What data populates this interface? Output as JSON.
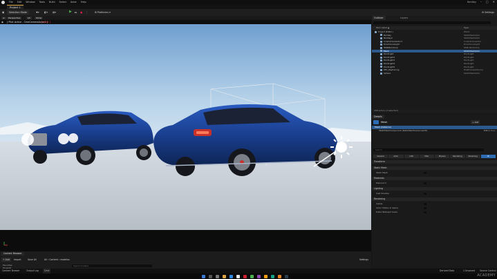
{
  "menu": [
    "File",
    "Edit",
    "Window",
    "Tools",
    "Build",
    "Select",
    "Actor",
    "Help"
  ],
  "project_tab": "Project 1",
  "project_name": "Bentley",
  "window_controls": [
    "–",
    "□",
    "✕"
  ],
  "toolbar": {
    "selection_mode": "Selection Mode",
    "platforms": "Platforms",
    "settings": "Settings"
  },
  "viewport": {
    "view_mode": "Perspective",
    "lit": "Lit",
    "show": "Show",
    "pilot_text": "[ Pilot Active - CineCameraActor1 ]",
    "pilot_exit": "[ eject ]"
  },
  "outliner": {
    "tab": "Outliner",
    "tab2": "Layers",
    "header_label": "Item Label ▲",
    "header_type": "Type",
    "rows": [
      {
        "label": "Project (Editor)",
        "type": "World",
        "indent": 0,
        "selected": false
      },
      {
        "label": "Bentley",
        "type": "StaticMeshActor",
        "indent": 1,
        "selected": false
      },
      {
        "label": "Bentley2",
        "type": "StaticMeshActor",
        "indent": 1,
        "selected": false
      },
      {
        "label": "CineCameraActor1",
        "type": "CineCameraActor",
        "indent": 1,
        "selected": false
      },
      {
        "label": "DirectionalLight",
        "type": "DirectionalLight",
        "indent": 1,
        "selected": false
      },
      {
        "label": "HDRIBackdrop",
        "type": "HDRI BACKdrop",
        "indent": 1,
        "selected": false
      },
      {
        "label": "Mesh",
        "type": "StaticMeshActor",
        "indent": 1,
        "selected": true
      },
      {
        "label": "PointLight",
        "type": "PointLight",
        "indent": 1,
        "selected": false
      },
      {
        "label": "PointLight2",
        "type": "PointLight",
        "indent": 1,
        "selected": false
      },
      {
        "label": "PointLight3",
        "type": "PointLight",
        "indent": 1,
        "selected": false
      },
      {
        "label": "PointLight4",
        "type": "PointLight",
        "indent": 1,
        "selected": false
      },
      {
        "label": "PointLight5",
        "type": "PointLight",
        "indent": 1,
        "selected": false
      },
      {
        "label": "PPV_Raytracing",
        "type": "PostProcessVolume",
        "indent": 1,
        "selected": false
      },
      {
        "label": "Sphere",
        "type": "StaticMeshActor",
        "indent": 1,
        "selected": false
      }
    ],
    "footer": "156 actors (1 selected)"
  },
  "details": {
    "tab": "Details",
    "actor_name": "Mesh",
    "add_button": "+ Add",
    "root_component": "Mesh (Instance)",
    "component": "StaticMeshComponent (StaticMeshComponent0)",
    "edit_label": "Edit in C++",
    "search_placeholder": "Search",
    "filter_tabs": [
      "General",
      "Actor",
      "LOD",
      "Misc",
      "Physics",
      "Rendering",
      "Streaming",
      "All"
    ],
    "sections": [
      {
        "name": "Transform",
        "rows": []
      },
      {
        "name": "Static Mesh",
        "rows": [
          "Static Mesh"
        ]
      },
      {
        "name": "Materials",
        "rows": [
          "Element 0"
        ]
      },
      {
        "name": "Lighting",
        "rows": [
          "Cast Shadow"
        ]
      },
      {
        "name": "Rendering",
        "rows": [
          "Visible",
          "Actor Hidden In Game",
          "Editor Billboard Scale"
        ]
      }
    ]
  },
  "content_browser": {
    "tab": "Content Browser",
    "add": "+ Add",
    "import": "Import",
    "save_all": "Save All",
    "path": "All  ›  Content  ›  modelos",
    "settings": "Settings",
    "search_placeholder": "Search modelos",
    "favorites": "Favorites",
    "project": "Project2"
  },
  "status": {
    "drawer": "Content Drawer",
    "output_log": "Output Log",
    "cmd": "Cmd",
    "derived": "Derived Data",
    "unsaved": "1 Unsaved",
    "source_control": "Source Control"
  },
  "watermark": "ACADEMY",
  "colors": {
    "accent": "#2d6bb3",
    "selection": "#2d5a8e",
    "car": "#1a3f8f"
  }
}
